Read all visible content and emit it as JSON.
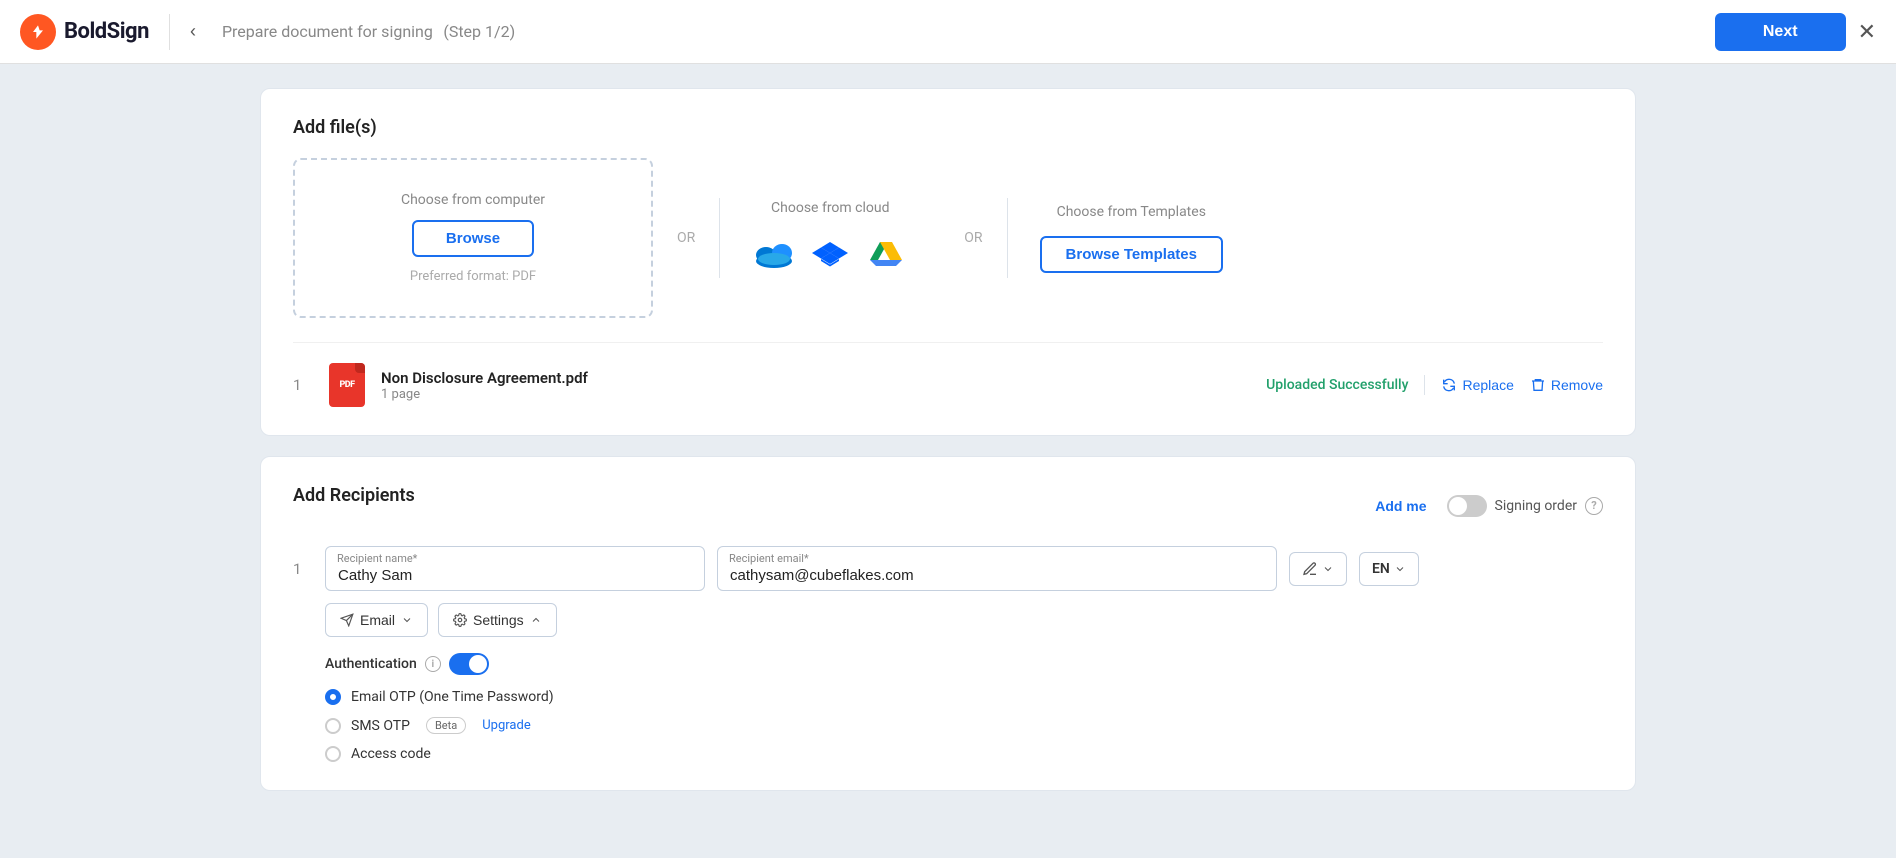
{
  "header": {
    "logo_text": "BoldSign",
    "back_label": "‹",
    "title": "Prepare document for signing",
    "step": "(Step 1/2)",
    "next_label": "Next",
    "close_label": "✕"
  },
  "add_files": {
    "section_title": "Add file(s)",
    "choose_computer_label": "Choose from computer",
    "browse_label": "Browse",
    "preferred_format": "Preferred format: PDF",
    "or1": "OR",
    "choose_cloud_label": "Choose from cloud",
    "or2": "OR",
    "choose_templates_label": "Choose from Templates",
    "browse_templates_label": "Browse Templates"
  },
  "uploaded_file": {
    "index": "1",
    "name": "Non Disclosure Agreement.pdf",
    "pages": "1 page",
    "status": "Uploaded Successfully",
    "replace_label": "Replace",
    "remove_label": "Remove"
  },
  "recipients": {
    "section_title": "Add Recipients",
    "add_me_label": "Add me",
    "signing_order_label": "Signing order",
    "recipient_index": "1",
    "name_label": "Recipient name*",
    "name_value": "Cathy Sam",
    "email_label": "Recipient email*",
    "email_value": "cathysam@cubeflakes.com",
    "action_label": "✏",
    "lang_label": "EN",
    "email_type_label": "Email",
    "settings_label": "Settings",
    "auth_label": "Authentication",
    "email_otp_label": "Email OTP (One Time Password)",
    "sms_otp_label": "SMS OTP",
    "sms_badge": "Beta",
    "upgrade_label": "Upgrade",
    "access_code_label": "Access code"
  }
}
